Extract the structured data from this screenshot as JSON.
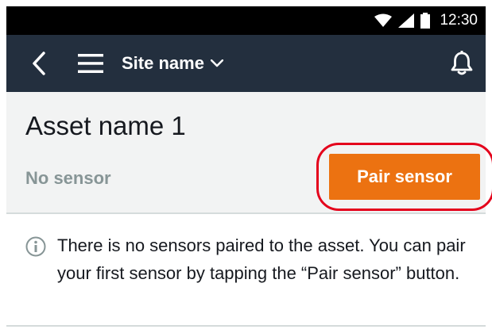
{
  "status_bar": {
    "time": "12:30",
    "icons": [
      "wifi-icon",
      "signal-icon",
      "battery-icon"
    ]
  },
  "app_bar": {
    "back_icon": "chevron-left-icon",
    "menu_icon": "hamburger-menu-icon",
    "site_selector_label": "Site name",
    "site_selector_icon": "chevron-down-icon",
    "notifications_icon": "bell-icon"
  },
  "asset_card": {
    "title": "Asset name 1",
    "sensor_status": "No sensor",
    "pair_button_label": "Pair sensor"
  },
  "info_message": {
    "icon": "info-icon",
    "text": "There is no sensors paired to the asset. You can pair your first sensor by tapping the “Pair sensor” button."
  },
  "colors": {
    "app_bar_bg": "#232f3e",
    "primary_button": "#ec7211",
    "highlight_ring": "#e4001b",
    "muted_text": "#879596"
  }
}
